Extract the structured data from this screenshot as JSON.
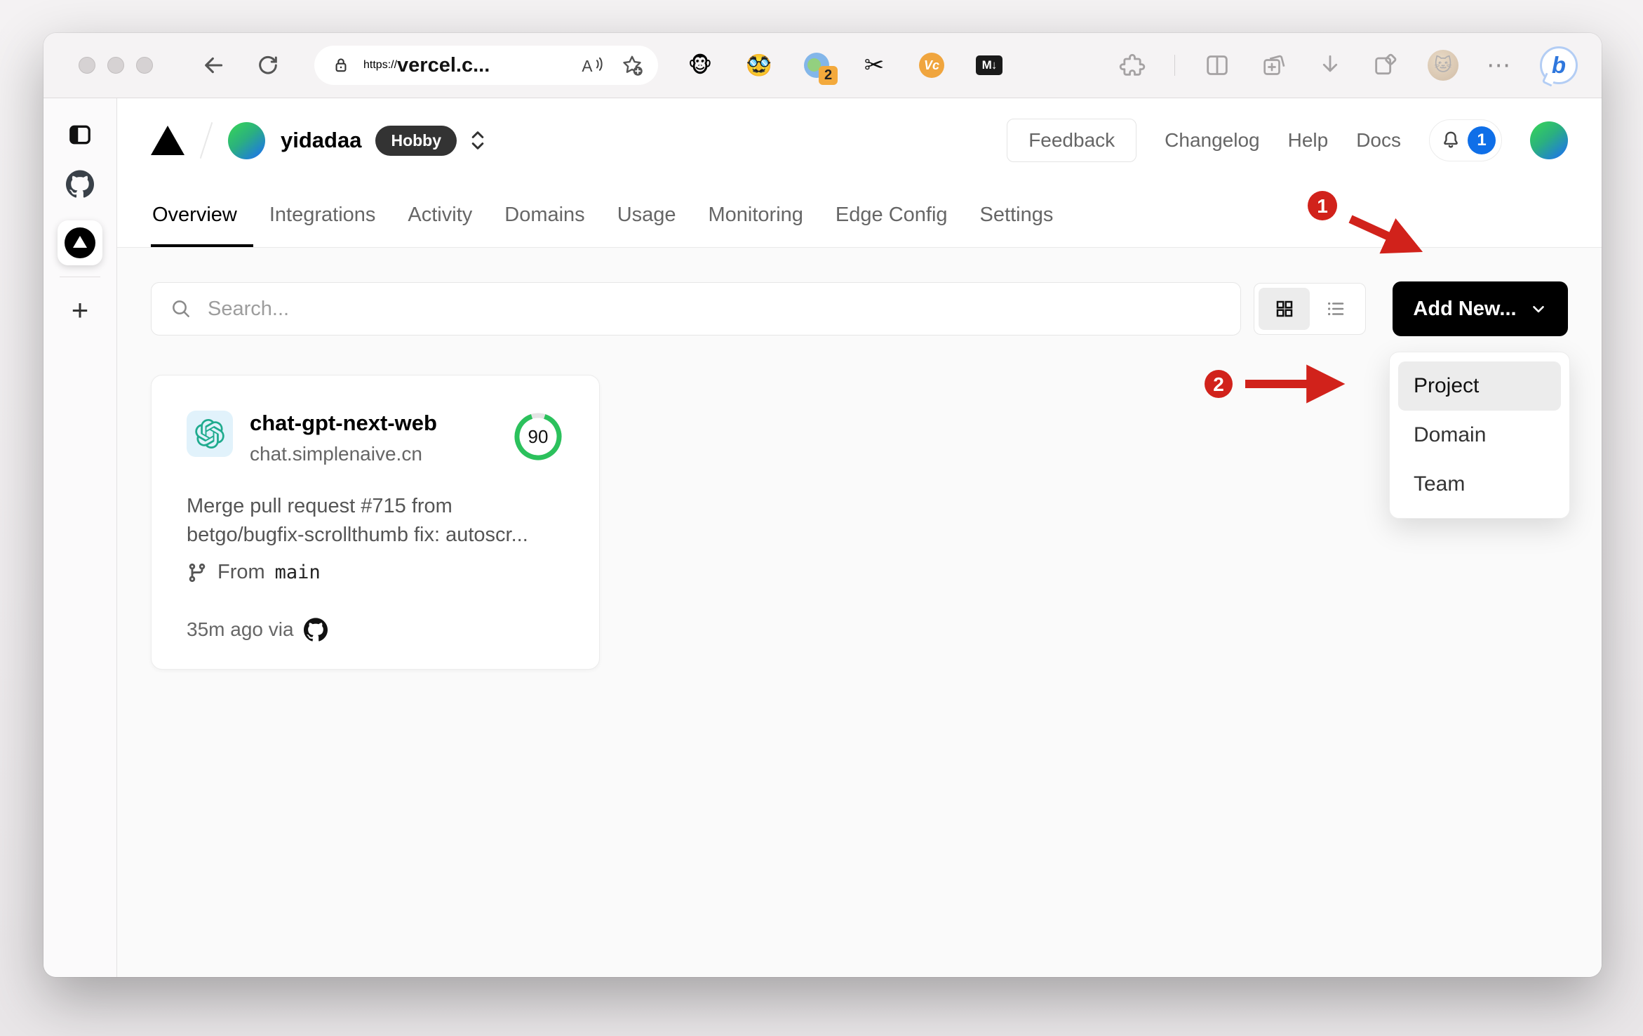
{
  "browser": {
    "url": {
      "scheme": "https://",
      "host": "vercel.c..."
    },
    "icons": {
      "tampermonkey": "🐵",
      "persona": "🥸",
      "translate_badge_count": "2",
      "scissors": "✂",
      "vc_label": "Vc",
      "markdown_label": "M↓",
      "profile": "🐱",
      "more": "⋯",
      "bing": "b"
    }
  },
  "sidebar": {
    "plus_label": "+"
  },
  "header": {
    "team": {
      "name": "yidadaa",
      "plan_badge": "Hobby"
    },
    "feedback_label": "Feedback",
    "links": [
      {
        "label": "Changelog"
      },
      {
        "label": "Help"
      },
      {
        "label": "Docs"
      }
    ],
    "notifications_count": "1"
  },
  "tabs": [
    {
      "label": "Overview",
      "active": true
    },
    {
      "label": "Integrations"
    },
    {
      "label": "Activity"
    },
    {
      "label": "Domains"
    },
    {
      "label": "Usage"
    },
    {
      "label": "Monitoring"
    },
    {
      "label": "Edge Config"
    },
    {
      "label": "Settings"
    }
  ],
  "toolbar": {
    "search_placeholder": "Search...",
    "add_new_label": "Add New..."
  },
  "dropdown": {
    "items": [
      {
        "label": "Project",
        "highlighted": true
      },
      {
        "label": "Domain"
      },
      {
        "label": "Team"
      }
    ]
  },
  "project_card": {
    "name": "chat-gpt-next-web",
    "domain": "chat.simplenaive.cn",
    "score": "90",
    "commit_line1": "Merge pull request #715 from",
    "commit_line2": "betgo/bugfix-scrollthumb fix: autoscr...",
    "branch_prefix": "From",
    "branch_name": "main",
    "deployed_via": "35m ago via"
  },
  "annotations": {
    "step1": "1",
    "step2": "2"
  },
  "colors": {
    "annotation_red": "#d1221b",
    "ring_green": "#2bc15c",
    "badge_blue": "#0f6fe8",
    "button_black": "#000000",
    "plan_badge_bg": "#333333",
    "avatar_gradient": [
      "#35cf5d",
      "#1e78e4"
    ]
  }
}
